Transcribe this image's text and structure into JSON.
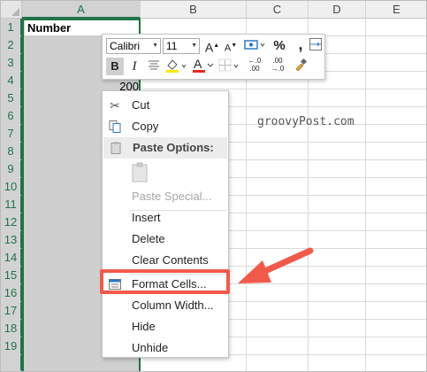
{
  "columns": [
    "A",
    "B",
    "C",
    "D",
    "E"
  ],
  "rows": [
    "1",
    "2",
    "3",
    "4",
    "5",
    "6",
    "7",
    "8",
    "9",
    "10",
    "11",
    "12",
    "13",
    "14",
    "15",
    "16",
    "17",
    "18",
    "19"
  ],
  "cells": {
    "a1": "Number",
    "a4": "200"
  },
  "watermark": "groovyPost.com",
  "mini_toolbar": {
    "font_name": "Calibri",
    "font_size": "11",
    "grow_font": "A",
    "shrink_font": "A",
    "percent": "%",
    "comma": ",",
    "bold": "B",
    "italic": "I",
    "font_color_letter": "A",
    "increase_decimal": "←.0\n.00",
    "decrease_decimal": ".00\n→.0"
  },
  "context_menu": {
    "cut": "Cut",
    "copy": "Copy",
    "paste_options": "Paste Options:",
    "paste_special": "Paste Special...",
    "insert": "Insert",
    "delete": "Delete",
    "clear_contents": "Clear Contents",
    "format_cells": "Format Cells...",
    "column_width": "Column Width...",
    "hide": "Hide",
    "unhide": "Unhide"
  },
  "colors": {
    "excel_green": "#217346",
    "annotation_red": "#f15a4b",
    "selection_gray": "#cfcfcf"
  }
}
